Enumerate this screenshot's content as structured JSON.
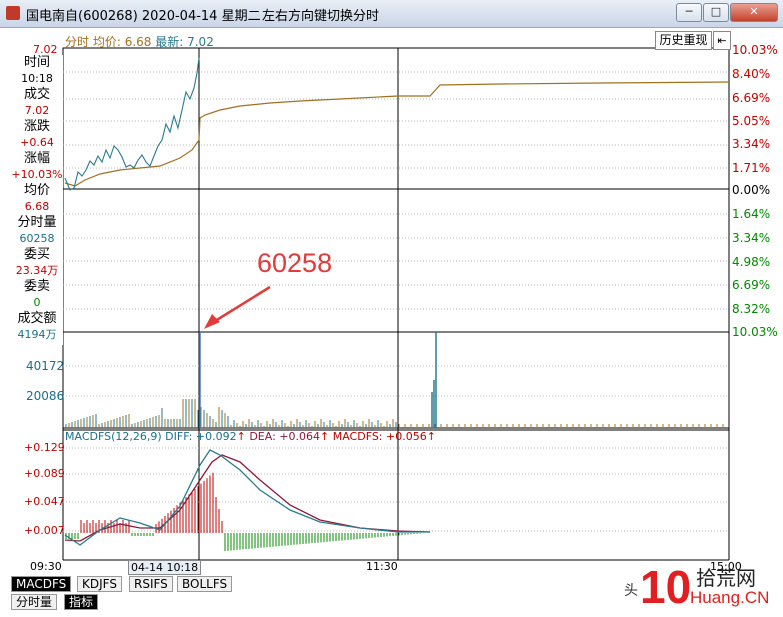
{
  "window": {
    "title": "国电南自(600268) 2020-04-14 星期二",
    "hint": "左右方向键切换分时",
    "min_label": "─",
    "max_label": "□",
    "close_label": "✕"
  },
  "header": {
    "series_label": "分时",
    "avg_label": "均价: 6.68",
    "last_label": "最新: 7.02",
    "history_button": "历史重现",
    "collapse_icon": "⇤"
  },
  "info": [
    {
      "label": "时间",
      "value": "10:18",
      "color": "black"
    },
    {
      "label": "成交",
      "value": "7.02",
      "color": "red"
    },
    {
      "label": "涨跌",
      "value": "+0.64",
      "color": "red"
    },
    {
      "label": "涨幅",
      "value": "+10.03%",
      "color": "red"
    },
    {
      "label": "均价",
      "value": "6.68",
      "color": "red"
    },
    {
      "label": "分时量",
      "value": "60258",
      "color": "teal"
    },
    {
      "label": "委买",
      "value": "23.34万",
      "color": "red"
    },
    {
      "label": "委卖",
      "value": "0",
      "color": "green"
    },
    {
      "label": "成交额",
      "value": "4194万",
      "color": "teal"
    }
  ],
  "price_axis": {
    "left_top": "7.02",
    "right_up": [
      "10.03%",
      "8.40%",
      "6.69%",
      "5.05%",
      "3.34%",
      "1.71%"
    ],
    "zero": "0.00%",
    "right_down": [
      "1.64%",
      "3.34%",
      "4.98%",
      "6.69%",
      "8.32%",
      "10.03%"
    ]
  },
  "volume_axis": [
    "40172",
    "20086"
  ],
  "annotation": {
    "text": "60258"
  },
  "macd": {
    "header_name": "MACDFS(12,26,9)",
    "diff_label": "DIFF: +0.092",
    "dea_label": "DEA: +0.064",
    "macd_label": "MACDFS: +0.056",
    "ticks": [
      "+0.129",
      "+0.089",
      "+0.047",
      "+0.007"
    ]
  },
  "time_axis": {
    "start": "09:30",
    "cursor": "04-14 10:18",
    "mid": "11:30",
    "end_partial": "15:00"
  },
  "indicator_tabs": [
    "MACDFS",
    "KDJFS",
    "RSIFS",
    "BOLLFS"
  ],
  "bottom_tabs": [
    "分时量",
    "指标"
  ],
  "watermark": {
    "prefix": "头",
    "number": "10",
    "top": "拾荒网",
    "bottom": "Huang.CN"
  },
  "colors": {
    "price_line": "#2b7a8c",
    "avg_line": "#a07020",
    "up": "#c00000",
    "down": "#008800",
    "accent": "#e23b3b"
  },
  "chart_data": {
    "type": "line",
    "title": "",
    "series": [
      {
        "name": "最新",
        "x": [
          "09:30",
          "09:40",
          "09:50",
          "10:00",
          "10:10",
          "10:15",
          "10:18"
        ],
        "values": [
          6.4,
          6.52,
          6.56,
          6.5,
          6.7,
          6.85,
          7.02
        ]
      },
      {
        "name": "均价",
        "x": [
          "09:30",
          "09:40",
          "09:50",
          "10:00",
          "10:10",
          "10:15",
          "10:18"
        ],
        "values": [
          6.38,
          6.44,
          6.48,
          6.49,
          6.53,
          6.58,
          6.68
        ]
      }
    ],
    "volume_markers": [
      40172,
      20086
    ],
    "highlight_volume": 60258
  }
}
